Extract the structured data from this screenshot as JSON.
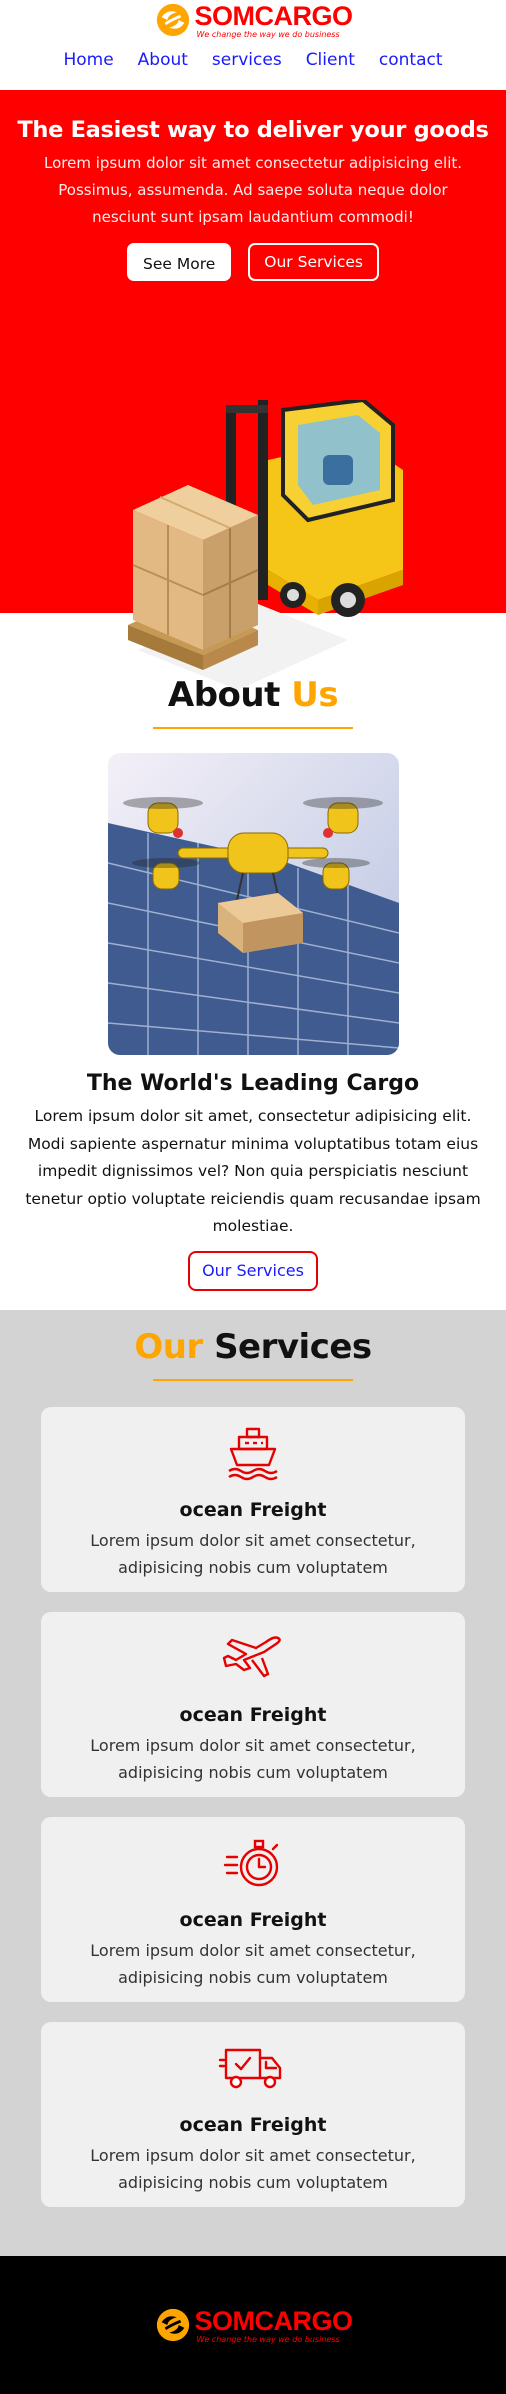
{
  "brand": {
    "name": "SOMCARGO",
    "tagline": "We change the way we do business",
    "color": "#ff0000",
    "accent": "#ffa500"
  },
  "nav": {
    "items": [
      {
        "label": "Home"
      },
      {
        "label": "About"
      },
      {
        "label": "services"
      },
      {
        "label": "Client"
      },
      {
        "label": "contact"
      }
    ]
  },
  "hero": {
    "title": "The Easiest way to deliver your goods",
    "text": "Lorem ipsum dolor sit amet consectetur adipisicing elit. Possimus, assumenda. Ad saepe soluta neque dolor nesciunt sunt ipsam laudantium commodi!",
    "primary_button": "See More",
    "secondary_button": "Our Services",
    "background": "#ff0000"
  },
  "about": {
    "title_main": "About",
    "title_accent": "Us",
    "subtitle": "The World's Leading Cargo",
    "text": "Lorem ipsum dolor sit amet, consectetur adipisicing elit. Modi sapiente aspernatur minima voluptatibus totam eius impedit dignissimos vel? Non quia perspiciatis nesciunt tenetur optio voluptate reiciendis quam recusandae ipsam molestiae.",
    "button": "Our Services"
  },
  "services": {
    "title_accent": "Our",
    "title_main": "Services",
    "cards": [
      {
        "icon": "ship-icon",
        "title": "ocean Freight",
        "text": "Lorem ipsum dolor sit amet consectetur, adipisicing nobis cum voluptatem"
      },
      {
        "icon": "airplane-icon",
        "title": "ocean Freight",
        "text": "Lorem ipsum dolor sit amet consectetur, adipisicing nobis cum voluptatem"
      },
      {
        "icon": "stopwatch-icon",
        "title": "ocean Freight",
        "text": "Lorem ipsum dolor sit amet consectetur, adipisicing nobis cum voluptatem"
      },
      {
        "icon": "delivery-truck-icon",
        "title": "ocean Freight",
        "text": "Lorem ipsum dolor sit amet consectetur, adipisicing nobis cum voluptatem"
      }
    ]
  },
  "footer": {
    "brand": "SOMCARGO",
    "tagline": "We change the way we do business"
  }
}
